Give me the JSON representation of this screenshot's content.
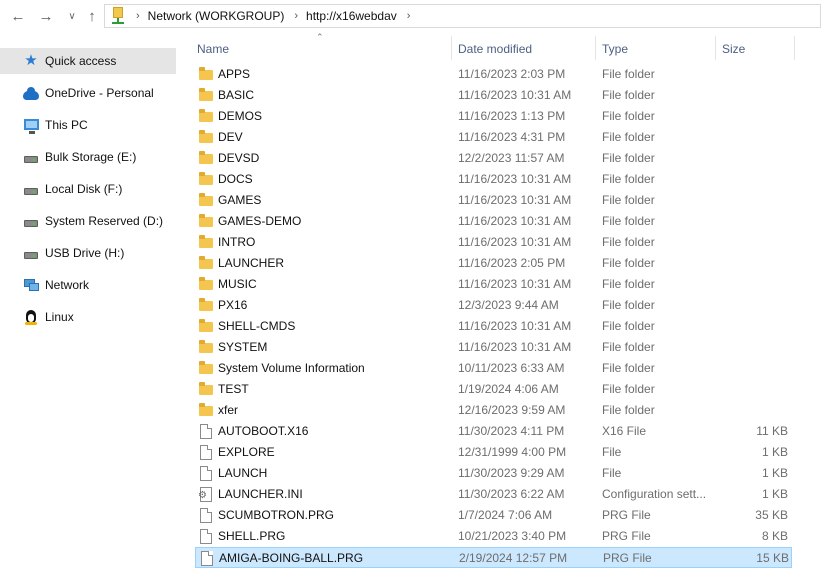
{
  "address": {
    "segments": [
      "Network (WORKGROUP)",
      "http://x16webdav"
    ]
  },
  "sidebar": {
    "items": [
      {
        "label": "Quick access",
        "icon": "star-icon",
        "selected": true
      },
      {
        "label": "OneDrive - Personal",
        "icon": "cloud-icon"
      },
      {
        "label": "This PC",
        "icon": "monitor-icon"
      },
      {
        "label": "Bulk Storage (E:)",
        "icon": "drive-icon"
      },
      {
        "label": "Local Disk (F:)",
        "icon": "drive-icon"
      },
      {
        "label": "System Reserved (D:)",
        "icon": "drive-icon"
      },
      {
        "label": "USB Drive (H:)",
        "icon": "drive-icon"
      },
      {
        "label": "Network",
        "icon": "network-icon"
      },
      {
        "label": "Linux",
        "icon": "penguin-icon"
      }
    ]
  },
  "columns": {
    "name": "Name",
    "date": "Date modified",
    "type": "Type",
    "size": "Size"
  },
  "files": [
    {
      "name": "APPS",
      "date": "11/16/2023 2:03 PM",
      "type": "File folder",
      "size": "",
      "icon": "folder-icon"
    },
    {
      "name": "BASIC",
      "date": "11/16/2023 10:31 AM",
      "type": "File folder",
      "size": "",
      "icon": "folder-icon"
    },
    {
      "name": "DEMOS",
      "date": "11/16/2023 1:13 PM",
      "type": "File folder",
      "size": "",
      "icon": "folder-icon"
    },
    {
      "name": "DEV",
      "date": "11/16/2023 4:31 PM",
      "type": "File folder",
      "size": "",
      "icon": "folder-icon"
    },
    {
      "name": "DEVSD",
      "date": "12/2/2023 11:57 AM",
      "type": "File folder",
      "size": "",
      "icon": "folder-icon"
    },
    {
      "name": "DOCS",
      "date": "11/16/2023 10:31 AM",
      "type": "File folder",
      "size": "",
      "icon": "folder-icon"
    },
    {
      "name": "GAMES",
      "date": "11/16/2023 10:31 AM",
      "type": "File folder",
      "size": "",
      "icon": "folder-icon"
    },
    {
      "name": "GAMES-DEMO",
      "date": "11/16/2023 10:31 AM",
      "type": "File folder",
      "size": "",
      "icon": "folder-icon"
    },
    {
      "name": "INTRO",
      "date": "11/16/2023 10:31 AM",
      "type": "File folder",
      "size": "",
      "icon": "folder-icon"
    },
    {
      "name": "LAUNCHER",
      "date": "11/16/2023 2:05 PM",
      "type": "File folder",
      "size": "",
      "icon": "folder-icon"
    },
    {
      "name": "MUSIC",
      "date": "11/16/2023 10:31 AM",
      "type": "File folder",
      "size": "",
      "icon": "folder-icon"
    },
    {
      "name": "PX16",
      "date": "12/3/2023 9:44 AM",
      "type": "File folder",
      "size": "",
      "icon": "folder-icon"
    },
    {
      "name": "SHELL-CMDS",
      "date": "11/16/2023 10:31 AM",
      "type": "File folder",
      "size": "",
      "icon": "folder-icon"
    },
    {
      "name": "SYSTEM",
      "date": "11/16/2023 10:31 AM",
      "type": "File folder",
      "size": "",
      "icon": "folder-icon"
    },
    {
      "name": "System Volume Information",
      "date": "10/11/2023 6:33 AM",
      "type": "File folder",
      "size": "",
      "icon": "folder-icon"
    },
    {
      "name": "TEST",
      "date": "1/19/2024 4:06 AM",
      "type": "File folder",
      "size": "",
      "icon": "folder-icon"
    },
    {
      "name": "xfer",
      "date": "12/16/2023 9:59 AM",
      "type": "File folder",
      "size": "",
      "icon": "folder-icon"
    },
    {
      "name": "AUTOBOOT.X16",
      "date": "11/30/2023 4:11 PM",
      "type": "X16 File",
      "size": "11 KB",
      "icon": "file-icon"
    },
    {
      "name": "EXPLORE",
      "date": "12/31/1999 4:00 PM",
      "type": "File",
      "size": "1 KB",
      "icon": "file-icon"
    },
    {
      "name": "LAUNCH",
      "date": "11/30/2023 9:29 AM",
      "type": "File",
      "size": "1 KB",
      "icon": "file-icon"
    },
    {
      "name": "LAUNCHER.INI",
      "date": "11/30/2023 6:22 AM",
      "type": "Configuration sett...",
      "size": "1 KB",
      "icon": "config-file-icon"
    },
    {
      "name": "SCUMBOTRON.PRG",
      "date": "1/7/2024 7:06 AM",
      "type": "PRG File",
      "size": "35 KB",
      "icon": "file-icon"
    },
    {
      "name": "SHELL.PRG",
      "date": "10/21/2023 3:40 PM",
      "type": "PRG File",
      "size": "8 KB",
      "icon": "file-icon"
    },
    {
      "name": "AMIGA-BOING-BALL.PRG",
      "date": "2/19/2024 12:57 PM",
      "type": "PRG File",
      "size": "15 KB",
      "icon": "file-icon",
      "selected": true
    }
  ]
}
